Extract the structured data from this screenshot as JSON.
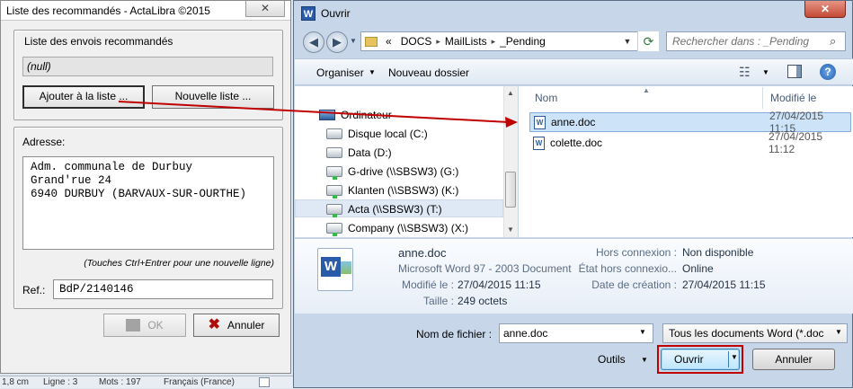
{
  "left_window": {
    "title": "Liste des recommandés - ActaLibra ©2015",
    "close_glyph": "✕",
    "list_group_label": "Liste des envois recommandés",
    "null_value": "(null)",
    "add_to_list_label": "Ajouter à la liste ...",
    "new_list_label": "Nouvelle liste ...",
    "address_group_label": "Adresse:",
    "address_text": "Adm. communale de Durbuy\nGrand'rue 24\n6940 DURBUY (BARVAUX-SUR-OURTHE)",
    "hint": "(Touches Ctrl+Entrer pour une nouvelle ligne)",
    "ref_label": "Ref.:",
    "ref_value": "BdP/2140146",
    "ok_label": "OK",
    "cancel_label": "Annuler"
  },
  "statusbar": {
    "position": "1,8 cm",
    "line": "Ligne : 3",
    "words": "Mots : 197",
    "language": "Français (France)"
  },
  "dialog": {
    "title": "Ouvrir",
    "close_glyph": "✕",
    "breadcrumb": [
      "«",
      "DOCS",
      "MailLists",
      "_Pending"
    ],
    "search_placeholder": "Rechercher dans : _Pending",
    "toolbar": {
      "organize": "Organiser",
      "new_folder": "Nouveau dossier",
      "help": "?"
    },
    "nav_items": [
      {
        "label": "Ordinateur",
        "icon": "computer-icon"
      },
      {
        "label": "Disque local (C:)",
        "icon": "drive-icon"
      },
      {
        "label": "Data (D:)",
        "icon": "drive-icon"
      },
      {
        "label": "G-drive (\\\\SBSW3) (G:)",
        "icon": "network-drive-icon"
      },
      {
        "label": "Klanten (\\\\SBSW3) (K:)",
        "icon": "network-drive-icon"
      },
      {
        "label": "Acta (\\\\SBSW3) (T:)",
        "icon": "network-drive-icon"
      },
      {
        "label": "Company (\\\\SBSW3) (X:)",
        "icon": "network-drive-icon"
      }
    ],
    "columns": {
      "name": "Nom",
      "modified": "Modifié le"
    },
    "files": [
      {
        "name": "anne.doc",
        "modified": "27/04/2015 11:15"
      },
      {
        "name": "colette.doc",
        "modified": "27/04/2015 11:12"
      }
    ],
    "details": {
      "file_name": "anne.doc",
      "file_type": "Microsoft Word 97 - 2003 Document",
      "modified_label": "Modifié le :",
      "modified_value": "27/04/2015 11:15",
      "size_label": "Taille :",
      "size_value": "249 octets",
      "offline_label": "Hors connexion :",
      "offline_value": "Non disponible",
      "offline_state_label": "État hors connexio...",
      "offline_state_value": "Online",
      "created_label": "Date de création :",
      "created_value": "27/04/2015 11:15"
    },
    "filename_label": "Nom de fichier :",
    "filename_value": "anne.doc",
    "filetype_value": "Tous les documents Word (*.doc",
    "tools_label": "Outils",
    "open_label": "Ouvrir",
    "cancel_label": "Annuler"
  },
  "colors": {
    "annotation_red": "#c00000",
    "dialog_bg": "#c7d6e8",
    "selection": "#cce3f8"
  }
}
